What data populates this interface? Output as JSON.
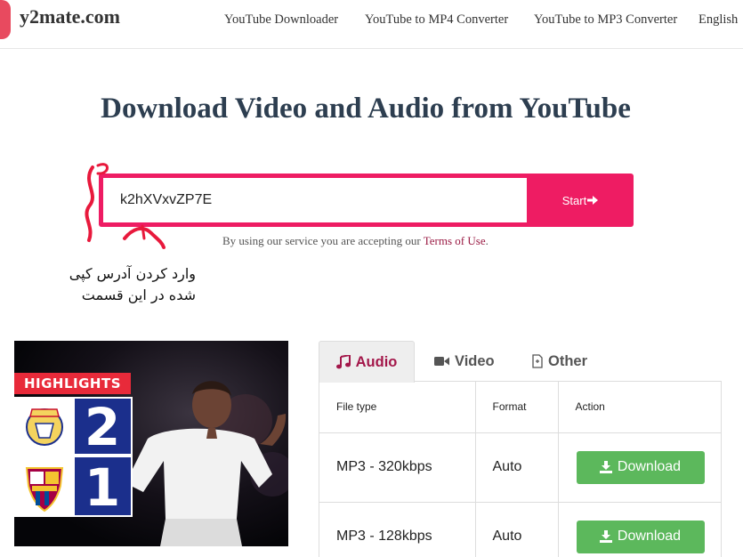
{
  "header": {
    "logo_text": "y2mate.com",
    "nav": [
      "YouTube Downloader",
      "YouTube to MP4 Converter",
      "YouTube to MP3 Converter",
      "English"
    ]
  },
  "title": "Download Video and Audio from YouTube",
  "search": {
    "value": "k2hXVxvZP7E",
    "button_label": "Start"
  },
  "terms": {
    "prefix": "By using our service you are accepting our ",
    "link": "Terms of Use",
    "suffix": "."
  },
  "annotation": {
    "line1": "وارد کردن آدرس کپی",
    "line2": "شده در این قسمت",
    "color": "#e8193c"
  },
  "thumbnail": {
    "label": "HIGHLIGHTS",
    "score_home": "2",
    "score_away": "1"
  },
  "tabs": [
    {
      "label": "Audio",
      "icon": "music-note-icon",
      "active": true
    },
    {
      "label": "Video",
      "icon": "video-camera-icon",
      "active": false
    },
    {
      "label": "Other",
      "icon": "file-icon",
      "active": false
    }
  ],
  "table": {
    "headers": [
      "File type",
      "Format",
      "Action"
    ],
    "rows": [
      {
        "file_type": "MP3 - 320kbps",
        "format": "Auto",
        "action": "Download"
      },
      {
        "file_type": "MP3 - 128kbps",
        "format": "Auto",
        "action": "Download"
      }
    ]
  },
  "colors": {
    "accent": "#ee1c63",
    "download": "#5cb85c",
    "tab_active": "#a3174a",
    "title": "#2d3e50"
  }
}
